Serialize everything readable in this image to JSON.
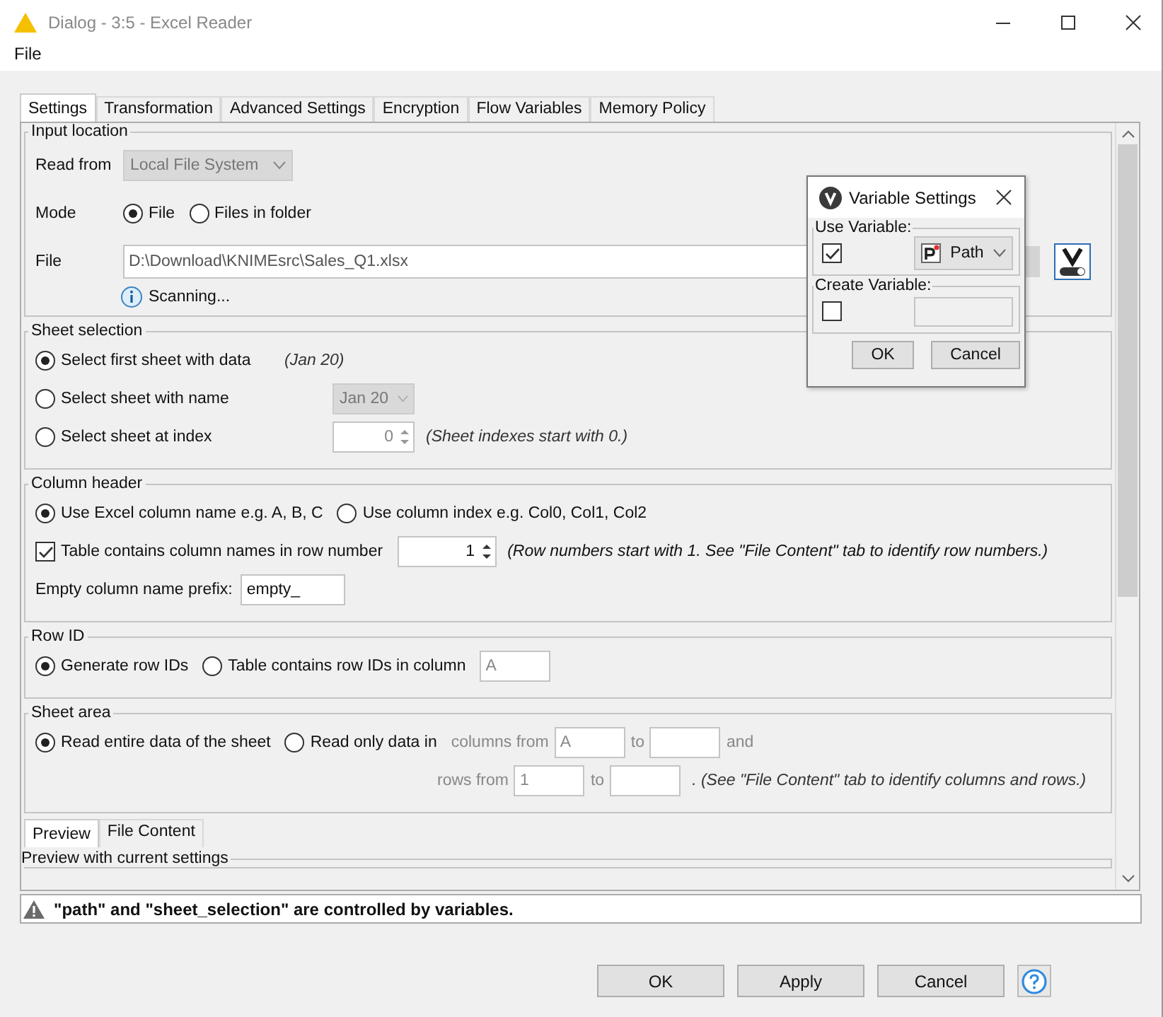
{
  "window": {
    "title": "Dialog - 3:5 - Excel Reader"
  },
  "menu": [
    {
      "label": "File"
    }
  ],
  "tabs": [
    {
      "label": "Settings",
      "selected": true
    },
    {
      "label": "Transformation",
      "selected": false
    },
    {
      "label": "Advanced Settings",
      "selected": false
    },
    {
      "label": "Encryption",
      "selected": false
    },
    {
      "label": "Flow Variables",
      "selected": false
    },
    {
      "label": "Memory Policy",
      "selected": false
    }
  ],
  "input_location": {
    "title": "Input location",
    "read_from": {
      "label": "Read from",
      "value": "Local File System",
      "disabled": true
    },
    "mode": {
      "label": "Mode",
      "options": [
        {
          "label": "File",
          "selected": true
        },
        {
          "label": "Files in folder",
          "selected": false
        }
      ]
    },
    "file": {
      "label": "File",
      "value": "D:\\Download\\KNIMEsrc\\Sales_Q1.xlsx"
    },
    "status": "Scanning..."
  },
  "sheet_selection": {
    "title": "Sheet selection",
    "options": [
      {
        "kind": "note",
        "label": "Select first sheet with data",
        "selected": true,
        "note": "(Jan 20)"
      },
      {
        "kind": "dropdown",
        "label": "Select sheet with name",
        "selected": false,
        "value": "Jan 20"
      },
      {
        "kind": "spinner",
        "label": "Select sheet at index",
        "selected": false,
        "value": "0",
        "note": "(Sheet indexes start with 0.)"
      }
    ]
  },
  "column_header": {
    "title": "Column header",
    "options": [
      {
        "label": "Use Excel column name e.g. A, B, C",
        "selected": true
      },
      {
        "label": "Use column index e.g. Col0, Col1, Col2",
        "selected": false
      }
    ],
    "names_in_row": {
      "label": "Table contains column names in row number",
      "checked": true,
      "value": "1",
      "note": "(Row numbers start with 1. See \"File Content\" tab to identify row numbers.)"
    },
    "prefix": {
      "label": "Empty column name prefix:",
      "value": "empty_"
    }
  },
  "row_id": {
    "title": "Row ID",
    "options": [
      {
        "label": "Generate row IDs",
        "selected": true
      },
      {
        "label": "Table contains row IDs in column",
        "selected": false
      }
    ],
    "column": "A"
  },
  "sheet_area": {
    "title": "Sheet area",
    "options": [
      {
        "label": "Read entire data of the sheet",
        "selected": true
      },
      {
        "label": "Read only data in",
        "selected": false
      }
    ],
    "columns": {
      "label": "columns from",
      "from": "A",
      "to": "to",
      "end": "and"
    },
    "rows": {
      "label": "rows from",
      "from": "1",
      "to": "to",
      "note": ". (See \"File Content\" tab to identify columns and rows.)"
    }
  },
  "preview_tabs": [
    {
      "label": "Preview",
      "selected": true
    },
    {
      "label": "File Content",
      "selected": false
    }
  ],
  "preview_title": "Preview with current settings",
  "warning": "\"path\" and \"sheet_selection\" are controlled by variables.",
  "buttons": [
    "OK",
    "Apply",
    "Cancel"
  ],
  "variable_settings": {
    "title": "Variable Settings",
    "use_variable": {
      "title": "Use Variable:",
      "checked": true,
      "variable": "Path"
    },
    "create_variable": {
      "title": "Create Variable:",
      "checked": false
    },
    "buttons": [
      "OK",
      "Cancel"
    ]
  }
}
